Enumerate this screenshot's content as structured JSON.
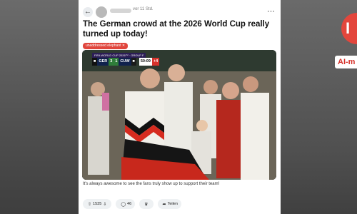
{
  "post": {
    "timestamp": "vor 11 Std.",
    "title": "The German crowd at the 2026 World Cup really turned up today!",
    "flair": "unaddressed elephant ✕",
    "caption": "It's always awesome to see the fans truly show up to support their team!"
  },
  "scoreboard": {
    "competition": "FIFA WORLD CUP 2026™ · GROUP F",
    "home_team": "GER",
    "home_score": "3",
    "away_team": "CUW",
    "away_score": "1",
    "clock": "50:09",
    "extra": "+4"
  },
  "actions": {
    "vote_count": "1535",
    "comment_count": "46",
    "share_label": "Teilen"
  },
  "overlay": {
    "brand_badge": "AI-m"
  },
  "colors": {
    "accent_red": "#e0453c",
    "pill_bg": "#eef1f3",
    "overlay_circle": "#e3463c"
  }
}
